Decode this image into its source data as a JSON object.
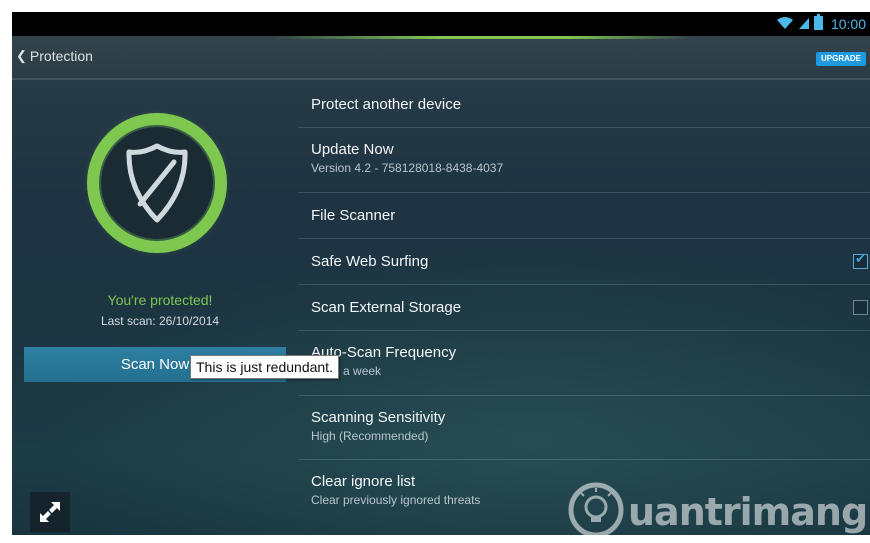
{
  "status_bar": {
    "time": "10:00",
    "icons": [
      "wifi-icon",
      "signal-icon",
      "battery-icon"
    ],
    "icon_color": "#4ab8e8"
  },
  "action_bar": {
    "back_label": "Protection",
    "upgrade_label": "UPGRADE"
  },
  "left_panel": {
    "status_text": "You're protected!",
    "last_scan": "Last scan: 26/10/2014",
    "scan_button": "Scan Now"
  },
  "settings": [
    {
      "title": "Protect another device"
    },
    {
      "title": "Update Now",
      "subtitle": "Version 4.2 - 758128018-8438-4037"
    },
    {
      "title": "File Scanner"
    },
    {
      "title": "Safe Web Surfing",
      "checked": true
    },
    {
      "title": "Scan External Storage",
      "checked": false
    },
    {
      "title": "Auto-Scan Frequency",
      "subtitle": "Once a week"
    },
    {
      "title": "Scanning Sensitivity",
      "subtitle": "High (Recommended)"
    },
    {
      "title": "Clear ignore list",
      "subtitle": "Clear previously ignored threats"
    }
  ],
  "tooltip": {
    "text": "This is just redundant."
  },
  "watermark": {
    "text": "uantrimang",
    "icon": "lightbulb-logo"
  },
  "colors": {
    "accent_green": "#7ec850",
    "accent_blue": "#1f9ae0",
    "scan_button": "#2a7a9c"
  }
}
